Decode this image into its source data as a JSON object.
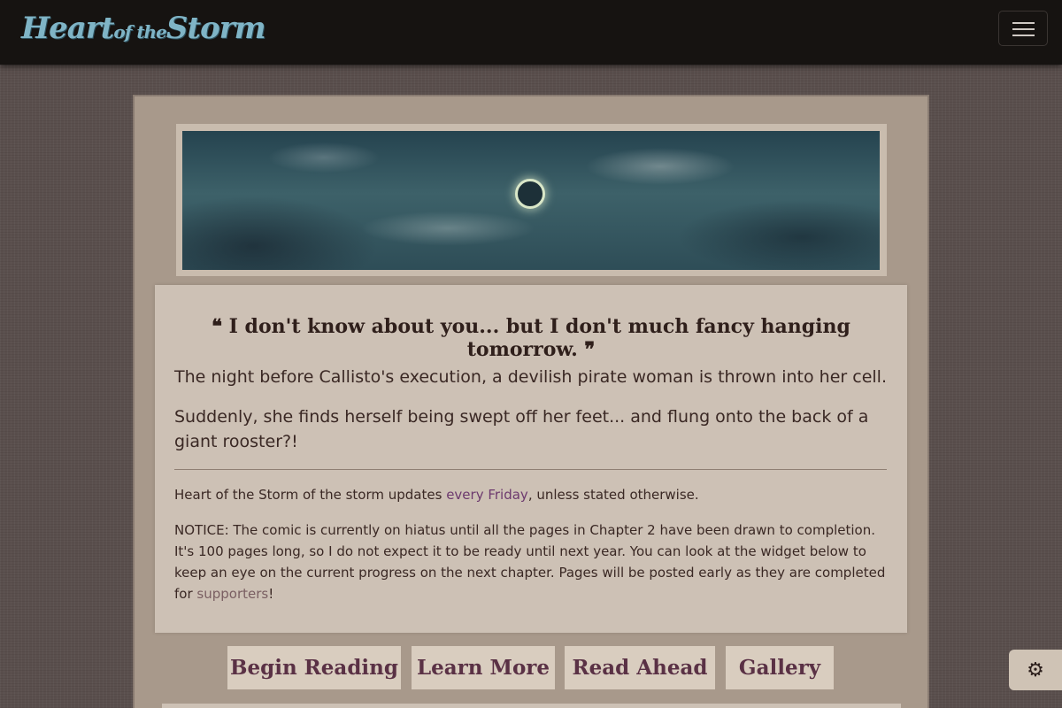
{
  "navbar": {
    "logo_part1": "Heart",
    "logo_part2": "of the",
    "logo_part3": "Storm"
  },
  "hero": {
    "quote": "❝ I don't know about you... but I don't much fancy hanging tomorrow. ❞",
    "synopsis_1": "The night before Callisto's execution, a devilish pirate woman is thrown into her cell.",
    "synopsis_2": "Suddenly, she finds herself being swept off her feet... and flung onto the back of a giant rooster?!"
  },
  "schedule": {
    "prefix": "Heart of the Storm of the storm updates ",
    "link": "every Friday",
    "suffix": ", unless stated otherwise."
  },
  "notice": {
    "text": "NOTICE: The comic is currently on hiatus until all the pages in Chapter 2 have been drawn to completion. It's 100 pages long, so I do not expect it to be ready until next year. You can look at the widget below to keep an eye on the current progress on the next chapter. Pages will be posted early as they are completed for ",
    "link": "supporters",
    "suffix": "!"
  },
  "buttons": {
    "begin": "Begin Reading",
    "learn": "Learn More",
    "ahead": "Read Ahead",
    "gallery": "Gallery"
  },
  "icons": {
    "settings": "gear-icon",
    "menu": "hamburger-icon"
  },
  "colors": {
    "navbar": "#161311",
    "logo": "#7fb4c6",
    "link": "#6d3a6e",
    "button_text": "#5a3145"
  }
}
